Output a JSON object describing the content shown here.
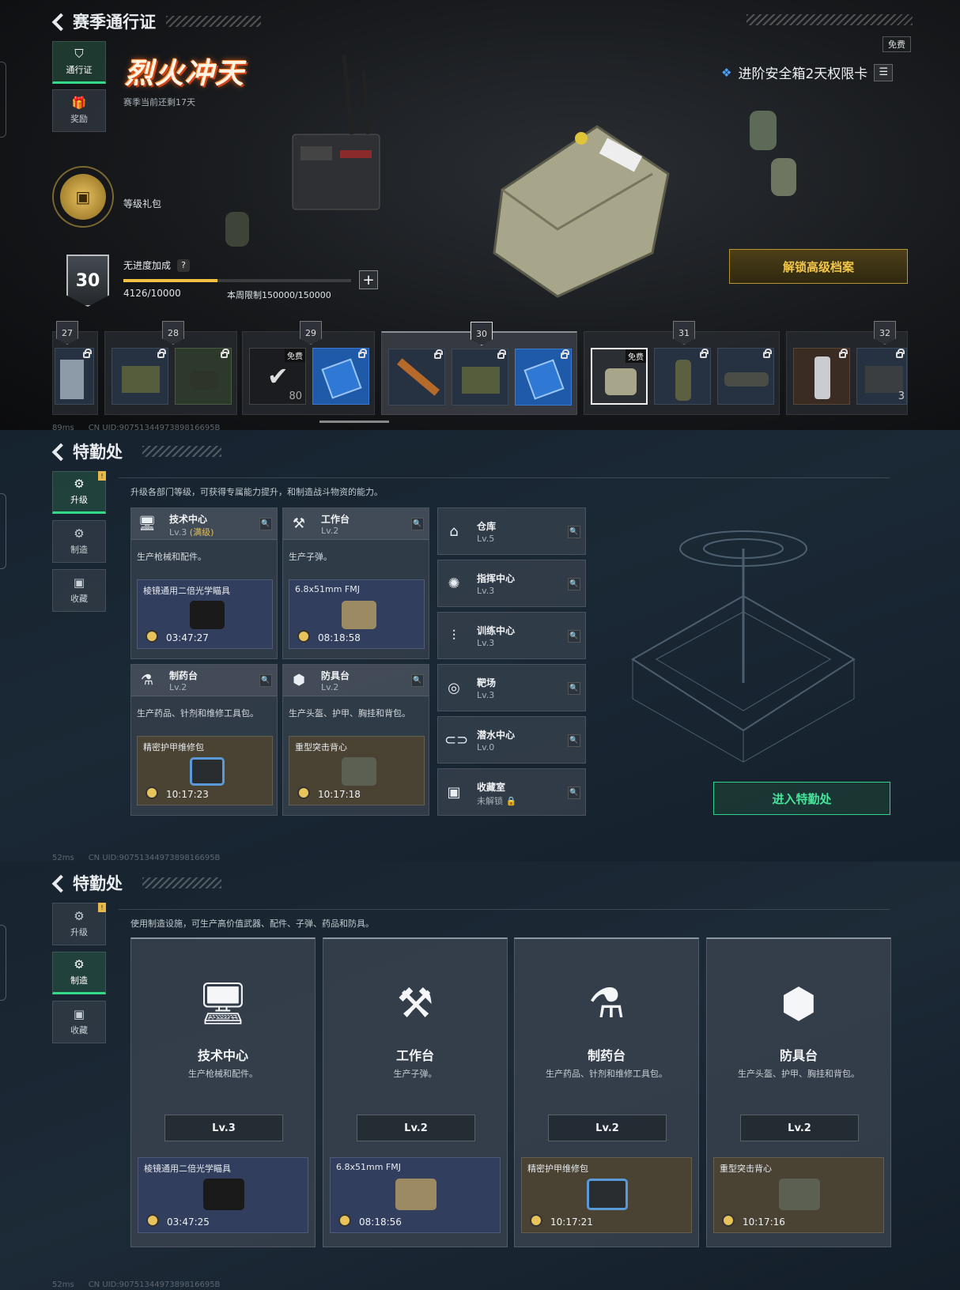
{
  "panel1": {
    "back_title": "赛季通行证",
    "nav": [
      {
        "icon": "pass-icon",
        "label": "通行证"
      },
      {
        "icon": "gift-icon",
        "label": "奖励"
      }
    ],
    "season_title": "烈火冲天",
    "season_remaining": "赛季当前还剩17天",
    "free_badge": "免费",
    "card_offer": "进阶安全箱2天权限卡",
    "level_gift": "等级礼包",
    "level": "30",
    "bonus_label": "无进度加成",
    "help": "?",
    "xp": "4126/10000",
    "xp_fraction": 0.4126,
    "weekly_limit": "本周限制150000/150000",
    "unlock_button": "解锁高级档案",
    "tiers": [
      {
        "num": "27"
      },
      {
        "num": "28"
      },
      {
        "num": "29",
        "free": "免费",
        "count": "80"
      },
      {
        "num": "30"
      },
      {
        "num": "31",
        "free": "免费"
      },
      {
        "num": "32",
        "count": "3"
      }
    ],
    "status_ping": "89ms",
    "status_uid": "CN UID:9075134497389816695B"
  },
  "panel2": {
    "back_title": "特勤处",
    "nav": [
      {
        "icon": "upgrade-icon",
        "label": "升级"
      },
      {
        "icon": "craft-icon",
        "label": "制造"
      },
      {
        "icon": "collection-icon",
        "label": "收藏"
      }
    ],
    "hint": "升级各部门等级，可获得专属能力提升，和制造战斗物资的能力。",
    "facilities": [
      {
        "name": "技术中心",
        "level": "Lv.3",
        "level_note": "(满级)",
        "desc": "生产枪械和配件。",
        "job": "棱镜通用二倍光学瞄具",
        "time": "03:47:27"
      },
      {
        "name": "工作台",
        "level": "Lv.2",
        "desc": "生产子弹。",
        "job": "6.8x51mm FMJ",
        "time": "08:18:58"
      },
      {
        "name": "制药台",
        "level": "Lv.2",
        "desc": "生产药品、针剂和维修工具包。",
        "job": "精密护甲维修包",
        "time": "10:17:23"
      },
      {
        "name": "防具台",
        "level": "Lv.2",
        "desc": "生产头盔、护甲、胸挂和背包。",
        "job": "重型突击背心",
        "time": "10:17:18"
      }
    ],
    "small_facilities": [
      {
        "name": "仓库",
        "level": "Lv.5"
      },
      {
        "name": "指挥中心",
        "level": "Lv.3"
      },
      {
        "name": "训练中心",
        "level": "Lv.3"
      },
      {
        "name": "靶场",
        "level": "Lv.3"
      },
      {
        "name": "潜水中心",
        "level": "Lv.0"
      },
      {
        "name": "收藏室",
        "level": "未解锁"
      }
    ],
    "enter_button": "进入特勤处",
    "status_ping": "52ms",
    "status_uid": "CN UID:9075134497389816695B"
  },
  "panel3": {
    "back_title": "特勤处",
    "nav": [
      {
        "icon": "upgrade-icon",
        "label": "升级"
      },
      {
        "icon": "craft-icon",
        "label": "制造"
      },
      {
        "icon": "collection-icon",
        "label": "收藏"
      }
    ],
    "hint": "使用制造设施，可生产高价值武器、配件、子弹、药品和防具。",
    "cards": [
      {
        "name": "技术中心",
        "desc": "生产枪械和配件。",
        "level": "Lv.3",
        "job": "棱镜通用二倍光学瞄具",
        "time": "03:47:25"
      },
      {
        "name": "工作台",
        "desc": "生产子弹。",
        "level": "Lv.2",
        "job": "6.8x51mm FMJ",
        "time": "08:18:56"
      },
      {
        "name": "制药台",
        "desc": "生产药品、针剂和维修工具包。",
        "level": "Lv.2",
        "job": "精密护甲维修包",
        "time": "10:17:21"
      },
      {
        "name": "防具台",
        "desc": "生产头盔、护甲、胸挂和背包。",
        "level": "Lv.2",
        "job": "重型突击背心",
        "time": "10:17:16"
      }
    ],
    "status_ping": "52ms",
    "status_uid": "CN UID:9075134497389816695B"
  },
  "colors": {
    "accent_green": "#34d98a",
    "gold": "#f1c64a",
    "level_gold": "#e3bd56"
  }
}
